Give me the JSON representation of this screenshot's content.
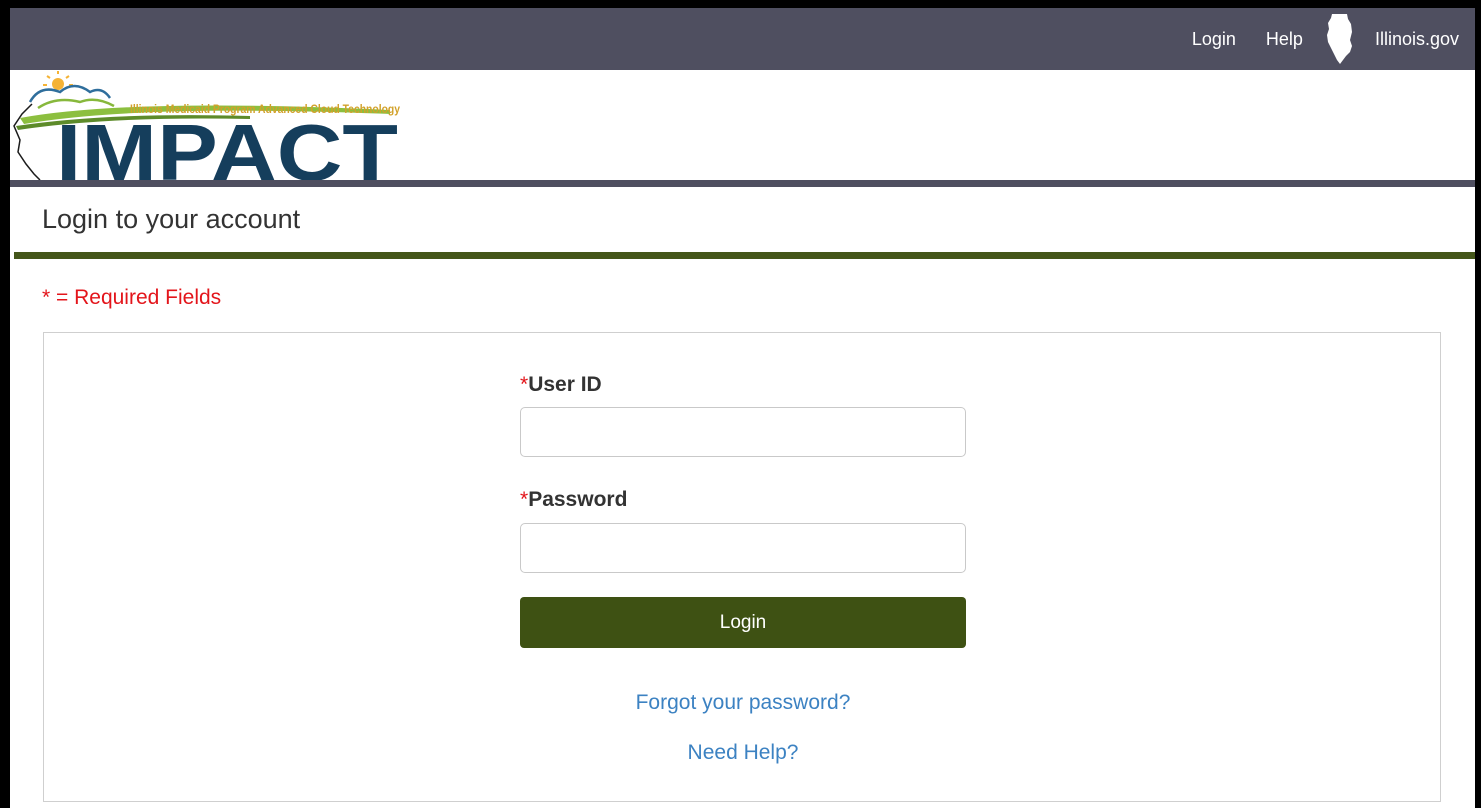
{
  "topbar": {
    "login_label": "Login",
    "help_label": "Help",
    "illinois_icon": "illinois-state-icon",
    "illinois_label": "Illinois.gov"
  },
  "logo": {
    "tagline": "Illinois Medicaid Program Advanced Cloud Technology",
    "wordmark": "IMPACT"
  },
  "page": {
    "title": "Login to your account",
    "required_note": "* = Required Fields"
  },
  "form": {
    "user_id_star": "*",
    "user_id_label": "User ID",
    "user_id_value": "",
    "password_star": "*",
    "password_label": "Password",
    "password_value": "",
    "login_button": "Login",
    "forgot_link": "Forgot your password?",
    "help_link": "Need Help?"
  },
  "colors": {
    "topbar": "#4f4f60",
    "brand_green": "#44561a",
    "button_green": "#3e5113",
    "required_red": "#e3151b",
    "link_blue": "#3c82c2",
    "logo_navy": "#153e5c"
  }
}
